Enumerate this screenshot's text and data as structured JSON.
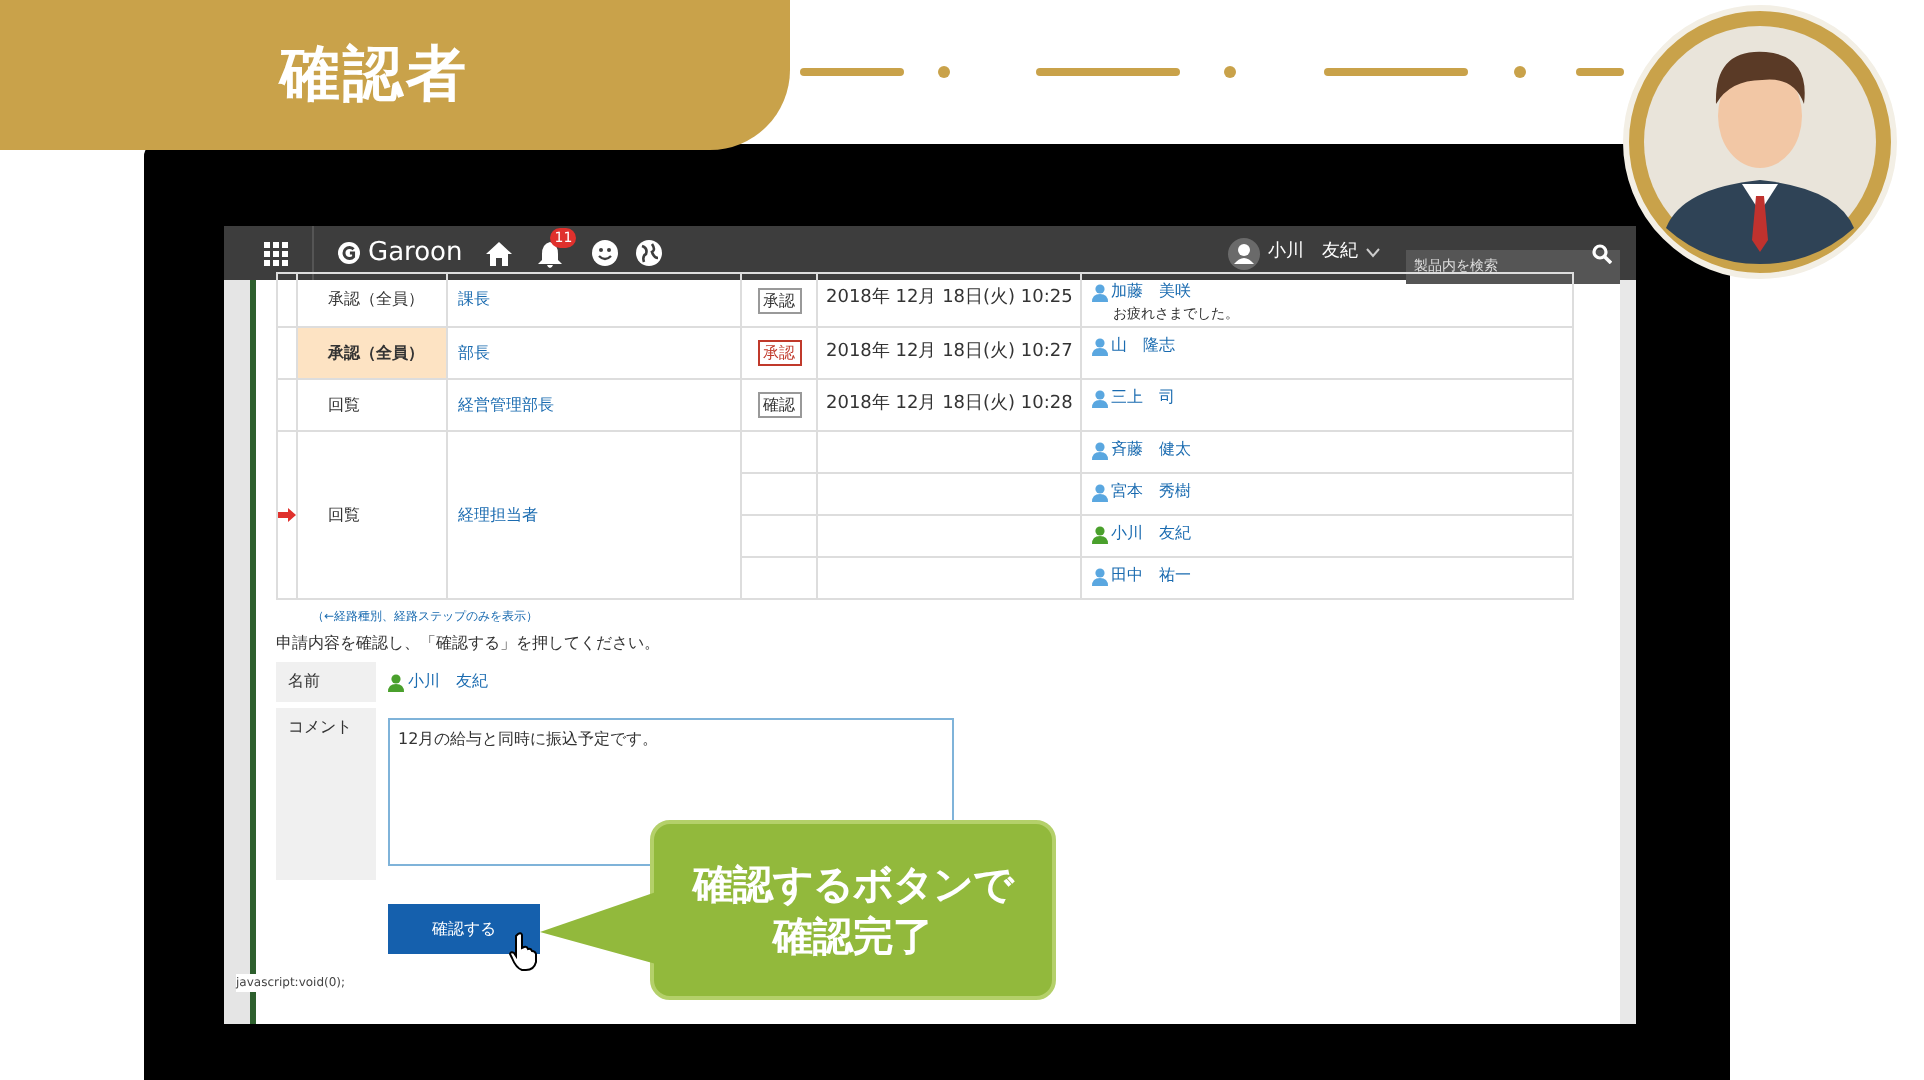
{
  "banner": {
    "title": "確認者"
  },
  "topbar": {
    "app_name": "Garoon",
    "notification_count": "11",
    "user_name": "小川　友紀",
    "search": {
      "placeholder": "製品内を検索"
    }
  },
  "route": {
    "steps": [
      {
        "type": "承認（全員）",
        "highlighted": false,
        "current": false,
        "role": "課長",
        "entries": [
          {
            "status": "承認",
            "status_emphasized": false,
            "date": "2018年 12月 18日(火) 10:25",
            "user": "加藤　美咲",
            "self": false,
            "comment": "お疲れさまでした。"
          }
        ]
      },
      {
        "type": "承認（全員）",
        "highlighted": true,
        "current": false,
        "role": "部長",
        "entries": [
          {
            "status": "承認",
            "status_emphasized": true,
            "date": "2018年 12月 18日(火) 10:27",
            "user": "山　隆志",
            "self": false
          }
        ]
      },
      {
        "type": "回覧",
        "highlighted": false,
        "current": false,
        "role": "経営管理部長",
        "entries": [
          {
            "status": "確認",
            "status_emphasized": false,
            "date": "2018年 12月 18日(火) 10:28",
            "user": "三上　司",
            "self": false
          }
        ]
      },
      {
        "type": "回覧",
        "highlighted": false,
        "current": true,
        "role": "経理担当者",
        "entries": [
          {
            "user": "斉藤　健太",
            "self": false
          },
          {
            "user": "宮本　秀樹",
            "self": false
          },
          {
            "user": "小川　友紀",
            "self": true
          },
          {
            "user": "田中　祐一",
            "self": false
          }
        ]
      }
    ]
  },
  "route_link": "（←経路種別、経路ステップのみを表示）",
  "instruction": "申請内容を確認し、「確認する」を押してください。",
  "form": {
    "name_label": "名前",
    "name_value": "小川　友紀",
    "comment_label": "コメント",
    "comment_value": "12月の給与と同時に振込予定です。"
  },
  "confirm_button": "確認する",
  "status_text": "javascript:void(0);",
  "callout": {
    "lines": [
      "確認するボタンで",
      "確認完了"
    ]
  }
}
